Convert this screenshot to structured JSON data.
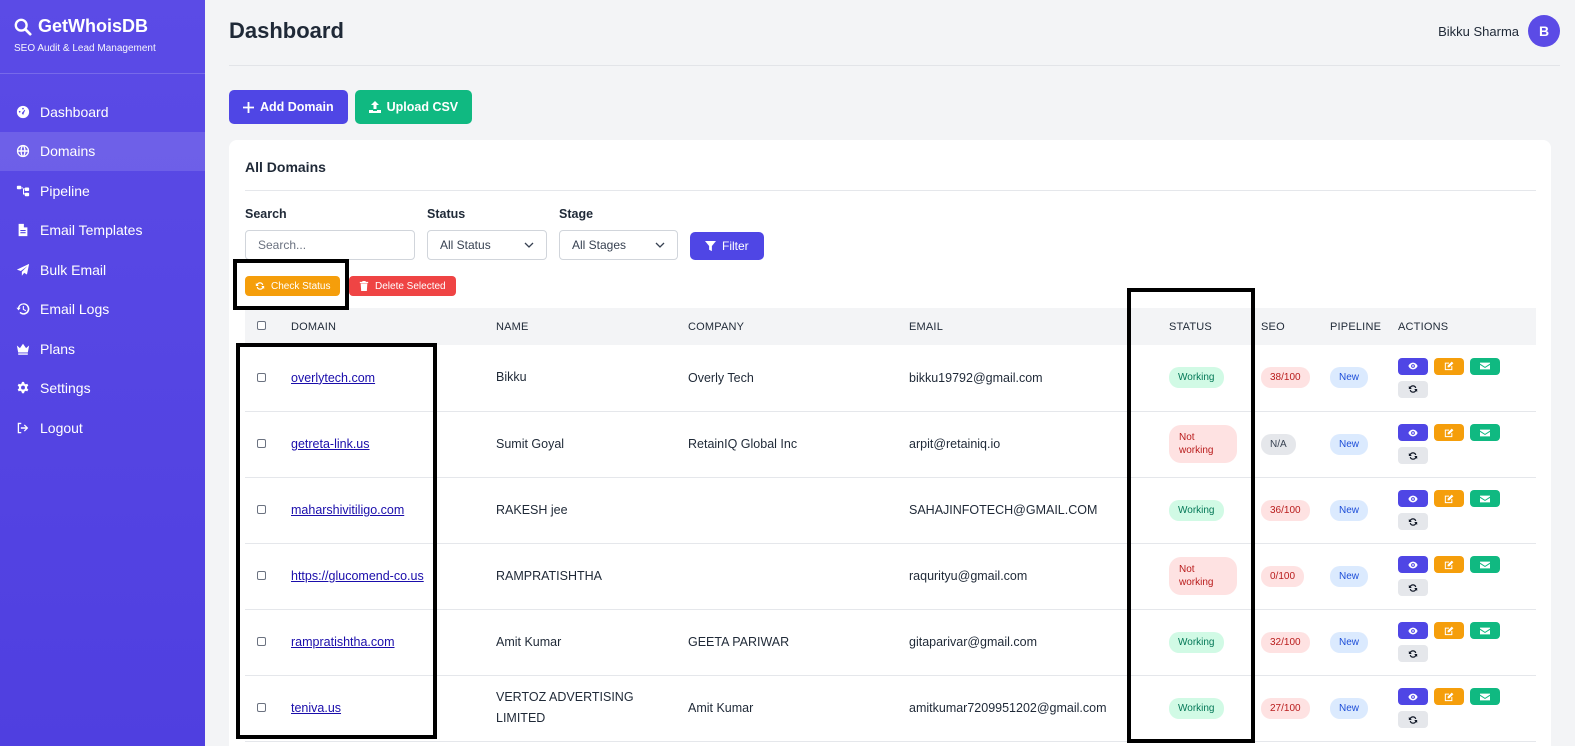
{
  "brand": {
    "title": "GetWhoisDB",
    "subtitle": "SEO Audit & Lead Management"
  },
  "sidebar": {
    "items": [
      {
        "label": "Dashboard",
        "icon": "gauge-icon"
      },
      {
        "label": "Domains",
        "icon": "globe-icon",
        "active": true
      },
      {
        "label": "Pipeline",
        "icon": "sitemap-icon"
      },
      {
        "label": "Email Templates",
        "icon": "file-icon"
      },
      {
        "label": "Bulk Email",
        "icon": "paper-plane-icon"
      },
      {
        "label": "Email Logs",
        "icon": "history-icon"
      },
      {
        "label": "Plans",
        "icon": "crown-icon"
      },
      {
        "label": "Settings",
        "icon": "gear-icon"
      },
      {
        "label": "Logout",
        "icon": "logout-icon"
      }
    ]
  },
  "header": {
    "title": "Dashboard",
    "user_name": "Bikku Sharma",
    "avatar_letter": "B"
  },
  "toolbar": {
    "add_domain": "Add Domain",
    "upload_csv": "Upload CSV"
  },
  "card": {
    "title": "All Domains",
    "filters": {
      "search_label": "Search",
      "search_placeholder": "Search...",
      "status_label": "Status",
      "status_value": "All Status",
      "stage_label": "Stage",
      "stage_value": "All Stages",
      "filter_button": "Filter"
    },
    "bulk": {
      "check_status": "Check Status",
      "delete_selected": "Delete Selected"
    }
  },
  "table": {
    "columns": [
      "DOMAIN",
      "NAME",
      "COMPANY",
      "EMAIL",
      "STATUS",
      "SEO",
      "PIPELINE",
      "ACTIONS"
    ],
    "rows": [
      {
        "domain": "overlytech.com",
        "name": "Bikku",
        "company": "Overly Tech",
        "email": "bikku19792@gmail.com",
        "status": "Working",
        "seo": "38/100",
        "pipeline": "New"
      },
      {
        "domain": "getreta-link.us",
        "name": "Sumit Goyal",
        "company": "RetainIQ Global Inc",
        "email": "arpit@retainiq.io",
        "status": "Not working",
        "seo": "N/A",
        "pipeline": "New"
      },
      {
        "domain": "maharshivitiligo.com",
        "name": "RAKESH jee",
        "company": "",
        "email": "SAHAJINFOTECH@GMAIL.COM",
        "status": "Working",
        "seo": "36/100",
        "pipeline": "New"
      },
      {
        "domain": "https://glucomend-co.us",
        "name": "RAMPRATISHTHA",
        "company": "",
        "email": "raqurityu@gmail.com",
        "status": "Not working",
        "seo": "0/100",
        "pipeline": "New"
      },
      {
        "domain": "rampratishtha.com",
        "name": "Amit Kumar",
        "company": "GEETA PARIWAR",
        "email": "gitaparivar@gmail.com",
        "status": "Working",
        "seo": "32/100",
        "pipeline": "New"
      },
      {
        "domain": "teniva.us",
        "name": "VERTOZ ADVERTISING LIMITED",
        "company": "Amit Kumar",
        "email": "amitkumar7209951202@gmail.com",
        "status": "Working",
        "seo": "27/100",
        "pipeline": "New"
      }
    ]
  }
}
